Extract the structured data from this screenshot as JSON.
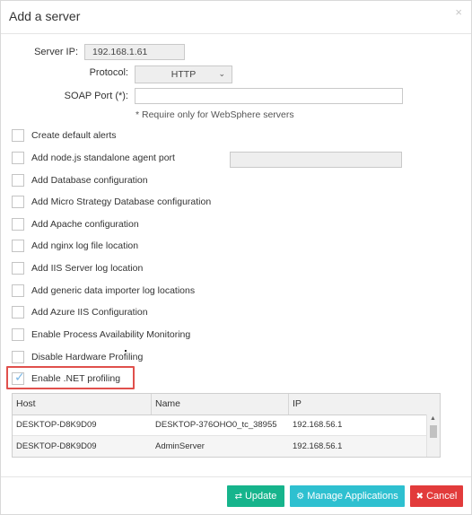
{
  "dialog": {
    "title": "Add a server",
    "close_icon": "close-icon"
  },
  "form": {
    "server_ip_label": "Server IP:",
    "server_ip_value": "192.168.1.61",
    "protocol_label": "Protocol:",
    "protocol_value": "HTTP",
    "soap_port_label": "SOAP Port (*):",
    "soap_port_value": "",
    "soap_hint": "* Require only for WebSphere servers"
  },
  "options": [
    {
      "label": "Create default alerts",
      "checked": false
    },
    {
      "label": "Add node.js standalone agent port",
      "checked": false
    },
    {
      "label": "Add Database configuration",
      "checked": false
    },
    {
      "label": "Add Micro Strategy Database configuration",
      "checked": false
    },
    {
      "label": "Add Apache configuration",
      "checked": false
    },
    {
      "label": "Add nginx log file location",
      "checked": false
    },
    {
      "label": "Add IIS Server log location",
      "checked": false
    },
    {
      "label": "Add generic data importer log locations",
      "checked": false
    },
    {
      "label": "Add Azure IIS Configuration",
      "checked": false
    },
    {
      "label": "Enable Process Availability Monitoring",
      "checked": false
    },
    {
      "label": "Disable Hardware Profiling",
      "checked": false
    },
    {
      "label": "Enable .NET profiling",
      "checked": true
    }
  ],
  "nodejs_port_value": "",
  "table": {
    "columns": [
      "Host",
      "Name",
      "IP"
    ],
    "rows": [
      [
        "DESKTOP-D8K9D09",
        "DESKTOP-376OHO0_tc_38955",
        "192.168.56.1"
      ],
      [
        "DESKTOP-D8K9D09",
        "AdminServer",
        "192.168.56.1"
      ]
    ]
  },
  "buttons": {
    "update": "Update",
    "manage": "Manage Applications",
    "cancel": "Cancel"
  },
  "colors": {
    "update": "#16b48c",
    "manage": "#2ec0d0",
    "cancel": "#e23b3b",
    "highlight": "#e0504c"
  }
}
